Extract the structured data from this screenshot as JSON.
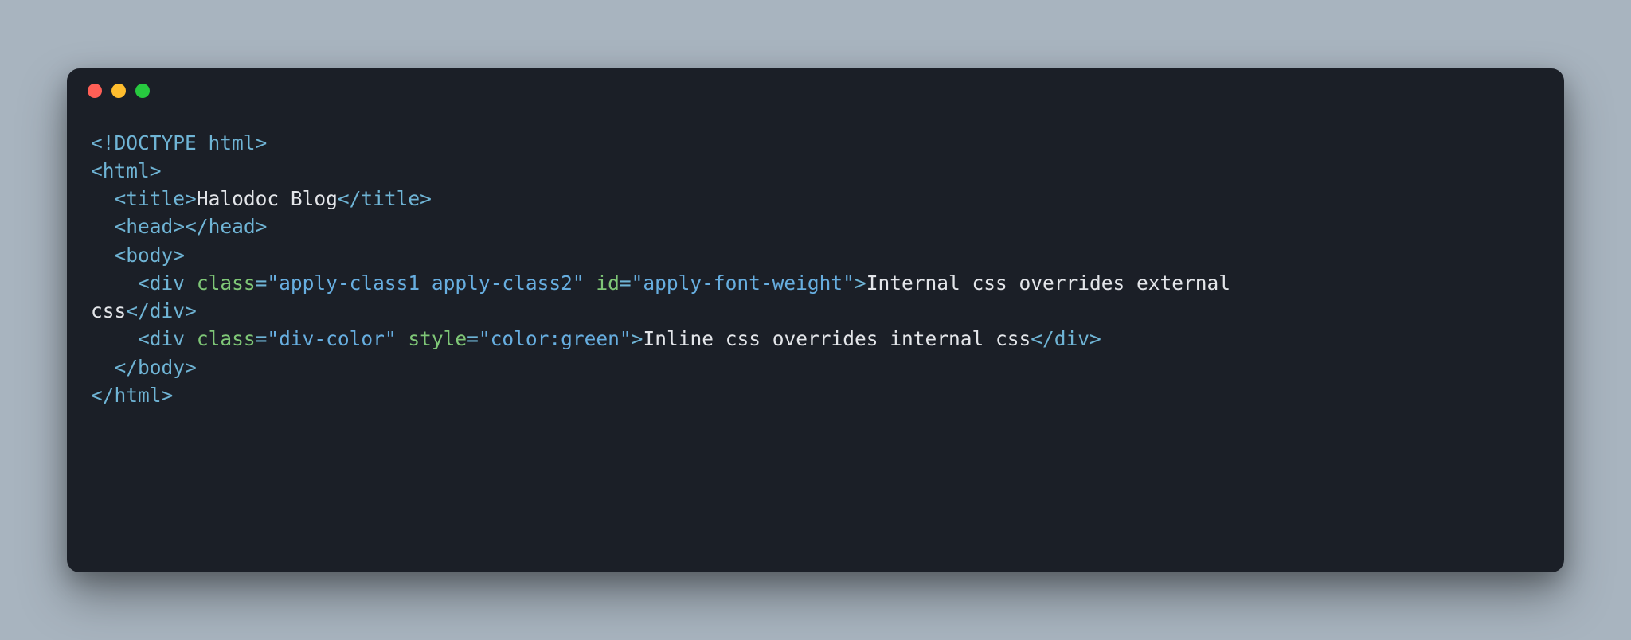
{
  "traffic_lights": {
    "red": "#ff5f56",
    "yellow": "#ffbd2e",
    "green": "#27c93f"
  },
  "code": {
    "lines": [
      {
        "indent": "",
        "tokens": [
          {
            "cls": "t-punc",
            "text": "<!"
          },
          {
            "cls": "t-doctype",
            "text": "DOCTYPE html"
          },
          {
            "cls": "t-punc",
            "text": ">"
          }
        ]
      },
      {
        "indent": "",
        "tokens": [
          {
            "cls": "t-punc",
            "text": "<"
          },
          {
            "cls": "t-tag",
            "text": "html"
          },
          {
            "cls": "t-punc",
            "text": ">"
          }
        ]
      },
      {
        "indent": "  ",
        "tokens": [
          {
            "cls": "t-punc",
            "text": "<"
          },
          {
            "cls": "t-tag",
            "text": "title"
          },
          {
            "cls": "t-punc",
            "text": ">"
          },
          {
            "cls": "t-text",
            "text": "Halodoc Blog"
          },
          {
            "cls": "t-punc",
            "text": "</"
          },
          {
            "cls": "t-tag",
            "text": "title"
          },
          {
            "cls": "t-punc",
            "text": ">"
          }
        ]
      },
      {
        "indent": "  ",
        "tokens": [
          {
            "cls": "t-punc",
            "text": "<"
          },
          {
            "cls": "t-tag",
            "text": "head"
          },
          {
            "cls": "t-punc",
            "text": "></"
          },
          {
            "cls": "t-tag",
            "text": "head"
          },
          {
            "cls": "t-punc",
            "text": ">"
          }
        ]
      },
      {
        "indent": "  ",
        "tokens": [
          {
            "cls": "t-punc",
            "text": "<"
          },
          {
            "cls": "t-tag",
            "text": "body"
          },
          {
            "cls": "t-punc",
            "text": ">"
          }
        ]
      },
      {
        "indent": "    ",
        "tokens": [
          {
            "cls": "t-punc",
            "text": "<"
          },
          {
            "cls": "t-tag",
            "text": "div"
          },
          {
            "cls": "t-text",
            "text": " "
          },
          {
            "cls": "t-attr",
            "text": "class"
          },
          {
            "cls": "t-punc",
            "text": "="
          },
          {
            "cls": "t-str",
            "text": "\"apply-class1 apply-class2\""
          },
          {
            "cls": "t-text",
            "text": " "
          },
          {
            "cls": "t-attr",
            "text": "id"
          },
          {
            "cls": "t-punc",
            "text": "="
          },
          {
            "cls": "t-str",
            "text": "\"apply-font-weight\""
          },
          {
            "cls": "t-punc",
            "text": ">"
          },
          {
            "cls": "t-text",
            "text": "Internal css overrides external "
          }
        ]
      },
      {
        "indent": "",
        "tokens": [
          {
            "cls": "t-text",
            "text": "css"
          },
          {
            "cls": "t-punc",
            "text": "</"
          },
          {
            "cls": "t-tag",
            "text": "div"
          },
          {
            "cls": "t-punc",
            "text": ">"
          }
        ]
      },
      {
        "indent": "    ",
        "tokens": [
          {
            "cls": "t-punc",
            "text": "<"
          },
          {
            "cls": "t-tag",
            "text": "div"
          },
          {
            "cls": "t-text",
            "text": " "
          },
          {
            "cls": "t-attr",
            "text": "class"
          },
          {
            "cls": "t-punc",
            "text": "="
          },
          {
            "cls": "t-str",
            "text": "\"div-color\""
          },
          {
            "cls": "t-text",
            "text": " "
          },
          {
            "cls": "t-attr",
            "text": "style"
          },
          {
            "cls": "t-punc",
            "text": "="
          },
          {
            "cls": "t-str",
            "text": "\"color:green\""
          },
          {
            "cls": "t-punc",
            "text": ">"
          },
          {
            "cls": "t-text",
            "text": "Inline css overrides internal css"
          },
          {
            "cls": "t-punc",
            "text": "</"
          },
          {
            "cls": "t-tag",
            "text": "div"
          },
          {
            "cls": "t-punc",
            "text": ">"
          }
        ]
      },
      {
        "indent": "  ",
        "tokens": [
          {
            "cls": "t-punc",
            "text": "</"
          },
          {
            "cls": "t-tag",
            "text": "body"
          },
          {
            "cls": "t-punc",
            "text": ">"
          }
        ]
      },
      {
        "indent": "",
        "tokens": [
          {
            "cls": "t-punc",
            "text": "</"
          },
          {
            "cls": "t-tag",
            "text": "html"
          },
          {
            "cls": "t-punc",
            "text": ">"
          }
        ]
      }
    ]
  }
}
